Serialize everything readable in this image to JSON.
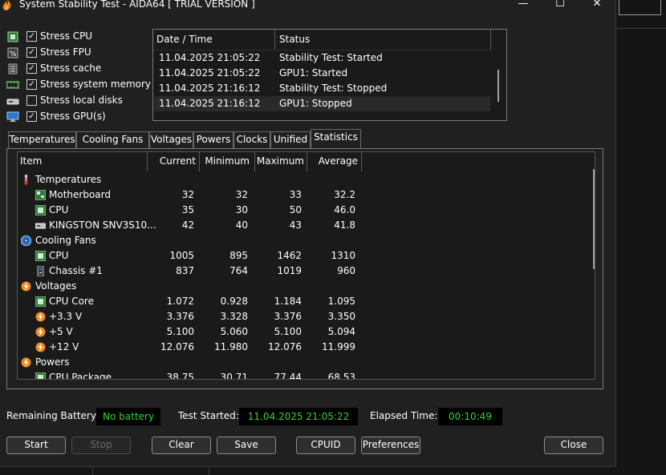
{
  "window": {
    "title": "System Stability Test - AIDA64  [ TRIAL VERSION ]",
    "minimize": "—",
    "maximize": "☐",
    "close": "✕"
  },
  "stress": [
    {
      "label": "Stress CPU",
      "checked": true
    },
    {
      "label": "Stress FPU",
      "checked": true
    },
    {
      "label": "Stress cache",
      "checked": true
    },
    {
      "label": "Stress system memory",
      "checked": true
    },
    {
      "label": "Stress local disks",
      "checked": false
    },
    {
      "label": "Stress GPU(s)",
      "checked": true
    }
  ],
  "log": {
    "headers": [
      "Date / Time",
      "Status"
    ],
    "rows": [
      {
        "date": "11.04.2025 21:05:22",
        "status": "Stability Test: Started"
      },
      {
        "date": "11.04.2025 21:05:22",
        "status": "GPU1: Started"
      },
      {
        "date": "11.04.2025 21:16:12",
        "status": "Stability Test: Stopped"
      },
      {
        "date": "11.04.2025 21:16:12",
        "status": "GPU1: Stopped"
      }
    ]
  },
  "tabs": [
    "Temperatures",
    "Cooling Fans",
    "Voltages",
    "Powers",
    "Clocks",
    "Unified",
    "Statistics"
  ],
  "active_tab": "Statistics",
  "grid": {
    "headers": [
      "Item",
      "Current",
      "Minimum",
      "Maximum",
      "Average"
    ],
    "rows": [
      {
        "type": "group",
        "icon": "thermometer-icon",
        "name": "Temperatures"
      },
      {
        "type": "item",
        "icon": "motherboard-icon",
        "name": "Motherboard",
        "cur": "32",
        "min": "32",
        "max": "33",
        "avg": "32.2"
      },
      {
        "type": "item",
        "icon": "cpu-chip-icon",
        "name": "CPU",
        "cur": "35",
        "min": "30",
        "max": "50",
        "avg": "46.0"
      },
      {
        "type": "item",
        "icon": "disk-drive-icon",
        "name": "KINGSTON SNV3S10...",
        "cur": "42",
        "min": "40",
        "max": "43",
        "avg": "41.8"
      },
      {
        "type": "group",
        "icon": "fan-icon",
        "name": "Cooling Fans"
      },
      {
        "type": "item",
        "icon": "cpu-chip-icon",
        "name": "CPU",
        "cur": "1005",
        "min": "895",
        "max": "1462",
        "avg": "1310"
      },
      {
        "type": "item",
        "icon": "chassis-icon",
        "name": "Chassis #1",
        "cur": "837",
        "min": "764",
        "max": "1019",
        "avg": "960"
      },
      {
        "type": "group",
        "icon": "lightning-icon",
        "name": "Voltages"
      },
      {
        "type": "item",
        "icon": "cpu-chip-icon",
        "name": "CPU Core",
        "cur": "1.072",
        "min": "0.928",
        "max": "1.184",
        "avg": "1.095"
      },
      {
        "type": "item",
        "icon": "lightning-icon",
        "name": "+3.3 V",
        "cur": "3.376",
        "min": "3.328",
        "max": "3.376",
        "avg": "3.350"
      },
      {
        "type": "item",
        "icon": "lightning-icon",
        "name": "+5 V",
        "cur": "5.100",
        "min": "5.060",
        "max": "5.100",
        "avg": "5.094"
      },
      {
        "type": "item",
        "icon": "lightning-icon",
        "name": "+12 V",
        "cur": "12.076",
        "min": "11.980",
        "max": "12.076",
        "avg": "11.999"
      },
      {
        "type": "group",
        "icon": "lightning-icon",
        "name": "Powers"
      },
      {
        "type": "item",
        "icon": "cpu-chip-icon",
        "name": "CPU Package",
        "cur": "38.75",
        "min": "30.71",
        "max": "77.44",
        "avg": "68.53"
      }
    ]
  },
  "status": {
    "battery_label": "Remaining Battery:",
    "battery_value": "No battery",
    "started_label": "Test Started:",
    "started_value": "11.04.2025 21:05:22",
    "elapsed_label": "Elapsed Time:",
    "elapsed_value": "00:10:49"
  },
  "buttons": {
    "start": "Start",
    "stop": "Stop",
    "clear": "Clear",
    "save": "Save",
    "cpuid": "CPUID",
    "preferences": "Preferences",
    "close": "Close"
  },
  "colors": {
    "status_green": "#2dd62d",
    "window_bg": "#202020",
    "grid_bg": "#1a1a1a"
  }
}
